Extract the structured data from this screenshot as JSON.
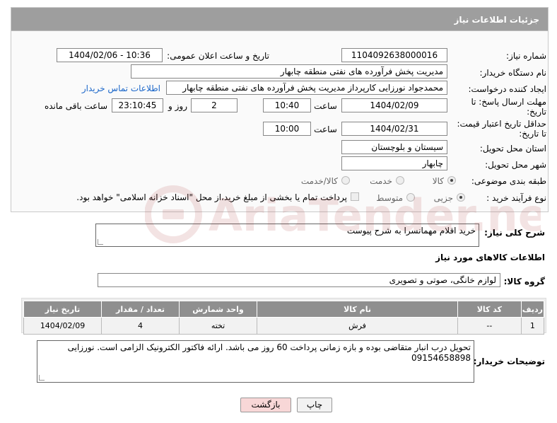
{
  "panel": {
    "title": "جزئیات اطلاعات نیاز"
  },
  "fields": {
    "need_number_label": "شماره نیاز:",
    "need_number": "1104092638000016",
    "announce_label": "تاریخ و ساعت اعلان عمومی:",
    "announce_value": "1404/02/06 - 10:36",
    "buyer_org_label": "نام دستگاه خریدار:",
    "buyer_org": "مدیریت پخش فرآورده های نفتی منطقه چابهار",
    "creator_label": "ایجاد کننده درخواست:",
    "creator": "محمدجواد نورزایی کارپرداز مدیریت پخش فرآورده های نفتی منطقه چابهار",
    "contact_link": "اطلاعات تماس خریدار",
    "deadline_label_1": "مهلت ارسال پاسخ: تا",
    "deadline_label_2": "تاریخ:",
    "deadline_date": "1404/02/09",
    "time_label": "ساعت",
    "deadline_time": "10:40",
    "days_value": "2",
    "days_label": "روز و",
    "remaining_time": "23:10:45",
    "remaining_label": "ساعت باقی مانده",
    "validity_label_1": "حداقل تاریخ اعتبار قیمت:",
    "validity_label_2": "تا تاریخ:",
    "validity_date": "1404/02/31",
    "validity_time": "10:00",
    "province_label": "استان محل تحویل:",
    "province": "سیستان و بلوچستان",
    "city_label": "شهر محل تحویل:",
    "city": "چابهار",
    "category_label": "طبقه بندی موضوعی:",
    "category_options": [
      "کالا",
      "خدمت",
      "کالا/خدمت"
    ],
    "process_label": "نوع فرآیند خرید :",
    "process_options": [
      "جزیی",
      "متوسط"
    ],
    "payment_note": "پرداخت تمام یا بخشی از مبلغ خرید،از محل \"اسناد خزانه اسلامی\" خواهد بود."
  },
  "description": {
    "label": "شرح کلی نیاز:",
    "value": "خرید اقلام مهمانسرا به شرح پیوست"
  },
  "goods": {
    "section_title": "اطلاعات کالاهای مورد نیاز",
    "group_label": "گروه کالا:",
    "group_value": "لوازم خانگی، صوتی و تصویری",
    "columns": [
      "ردیف",
      "کد کالا",
      "نام کالا",
      "واحد شمارش",
      "تعداد / مقدار",
      "تاریخ نیاز"
    ],
    "rows": [
      [
        "1",
        "--",
        "فرش",
        "تخته",
        "4",
        "1404/02/09"
      ]
    ]
  },
  "buyer_notes": {
    "label": "توضیحات خریدار:",
    "value": "تحویل درب انبار متقاضی بوده و بازه زمانی پرداخت 60 روز می باشد. ارائه فاکتور الکترونیک الزامی است. نورزایی 09154658898"
  },
  "buttons": {
    "print": "چاپ",
    "back": "بازگشت"
  },
  "colors": {
    "header": "#9e9e9e",
    "table_header": "#8f8f8f",
    "link": "#1a66c9",
    "back_button": "#f8d7d7"
  },
  "watermark": {
    "text": "AriaTender.neT"
  }
}
